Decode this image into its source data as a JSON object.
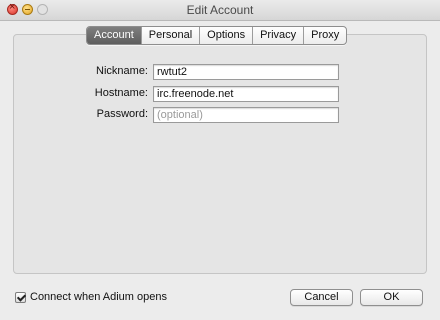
{
  "window": {
    "title": "Edit Account"
  },
  "tabs": [
    {
      "label": "Account",
      "active": true
    },
    {
      "label": "Personal",
      "active": false
    },
    {
      "label": "Options",
      "active": false
    },
    {
      "label": "Privacy",
      "active": false
    },
    {
      "label": "Proxy",
      "active": false
    }
  ],
  "form": {
    "nickname": {
      "label": "Nickname:",
      "value": "rwtut2"
    },
    "hostname": {
      "label": "Hostname:",
      "value": "irc.freenode.net"
    },
    "password": {
      "label": "Password:",
      "value": "",
      "placeholder": "(optional)"
    }
  },
  "footer": {
    "connect_label": "Connect when Adium opens",
    "connect_checked": true,
    "cancel_label": "Cancel",
    "ok_label": "OK"
  },
  "colors": {
    "active_tab": "#6b6b6b",
    "background": "#ececec"
  }
}
